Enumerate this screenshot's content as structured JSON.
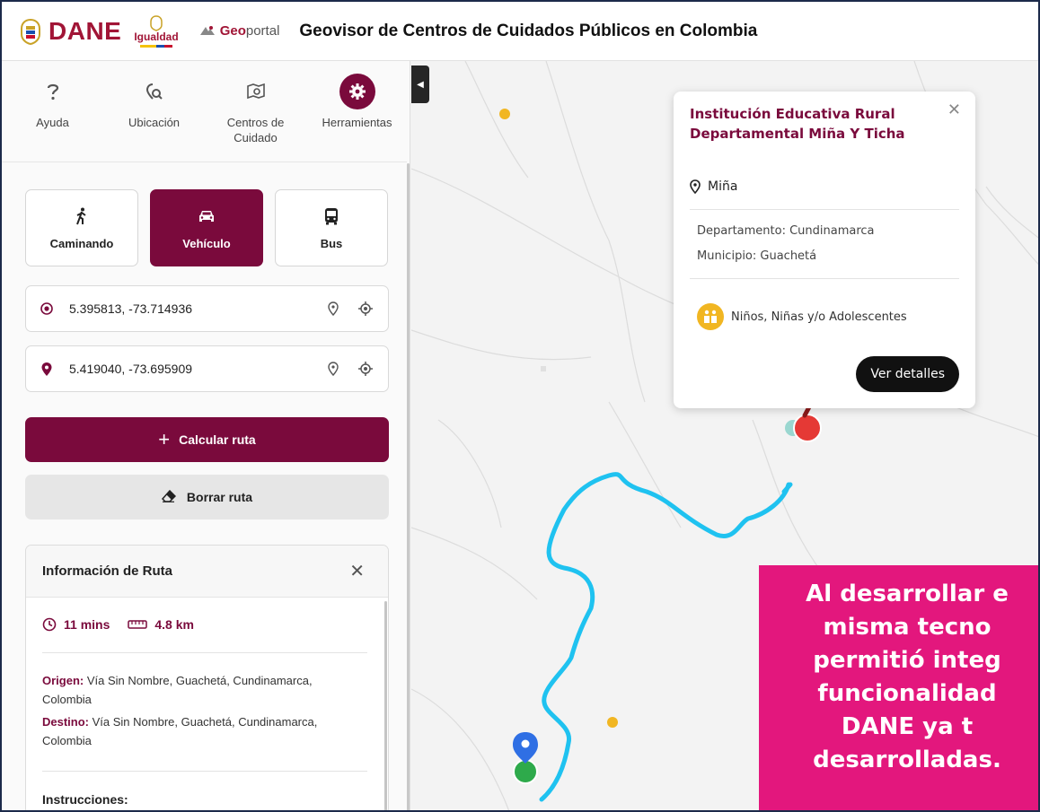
{
  "header": {
    "dane_logo": "DANE",
    "igualdad_logo": "Igualdad",
    "geoportal_prefix": "Geo",
    "geoportal_suffix": "portal",
    "title": "Geovisor de Centros de Cuidados Públicos en Colombia"
  },
  "toolbar": {
    "items": [
      {
        "label": "Ayuda",
        "icon": "help-icon"
      },
      {
        "label": "Ubicación",
        "icon": "location-search-icon"
      },
      {
        "label": "Centros de Cuidado",
        "icon": "map-search-icon"
      },
      {
        "label": "Herramientas",
        "icon": "gear-icon",
        "active": true
      }
    ]
  },
  "modes": [
    {
      "label": "Caminando",
      "icon": "walk-icon"
    },
    {
      "label": "Vehículo",
      "icon": "car-icon",
      "active": true
    },
    {
      "label": "Bus",
      "icon": "bus-icon"
    }
  ],
  "origin": {
    "value": "5.395813, -73.714936"
  },
  "destination": {
    "value": "5.419040, -73.695909"
  },
  "actions": {
    "calculate": "Calcular ruta",
    "clear": "Borrar ruta"
  },
  "route_info": {
    "title": "Información de Ruta",
    "duration": "11 mins",
    "distance": "4.8 km",
    "origin_label": "Origen:",
    "origin_value": " Vía Sin Nombre, Guachetá, Cundinamarca, Colombia",
    "destination_label": "Destino:",
    "destination_value": " Vía Sin Nombre, Guachetá, Cundinamarca, Colombia",
    "instructions_label": "Instrucciones:"
  },
  "popup": {
    "title": "Institución Educativa Rural Departamental Miña Y Ticha",
    "location": "Miña",
    "department": "Departamento: Cundinamarca",
    "municipality": "Municipio: Guachetá",
    "category": "Niños, Niñas y/o Adolescentes",
    "details_button": "Ver detalles"
  },
  "banner": {
    "lines": [
      "Al desarrollar e",
      "misma tecno",
      "permitió integ",
      "funcionalidad",
      "DANE ya t",
      "desarrolladas."
    ]
  },
  "colors": {
    "brand": "#7a0a3c",
    "route": "#1fc2f0",
    "banner": "#e3177d"
  }
}
